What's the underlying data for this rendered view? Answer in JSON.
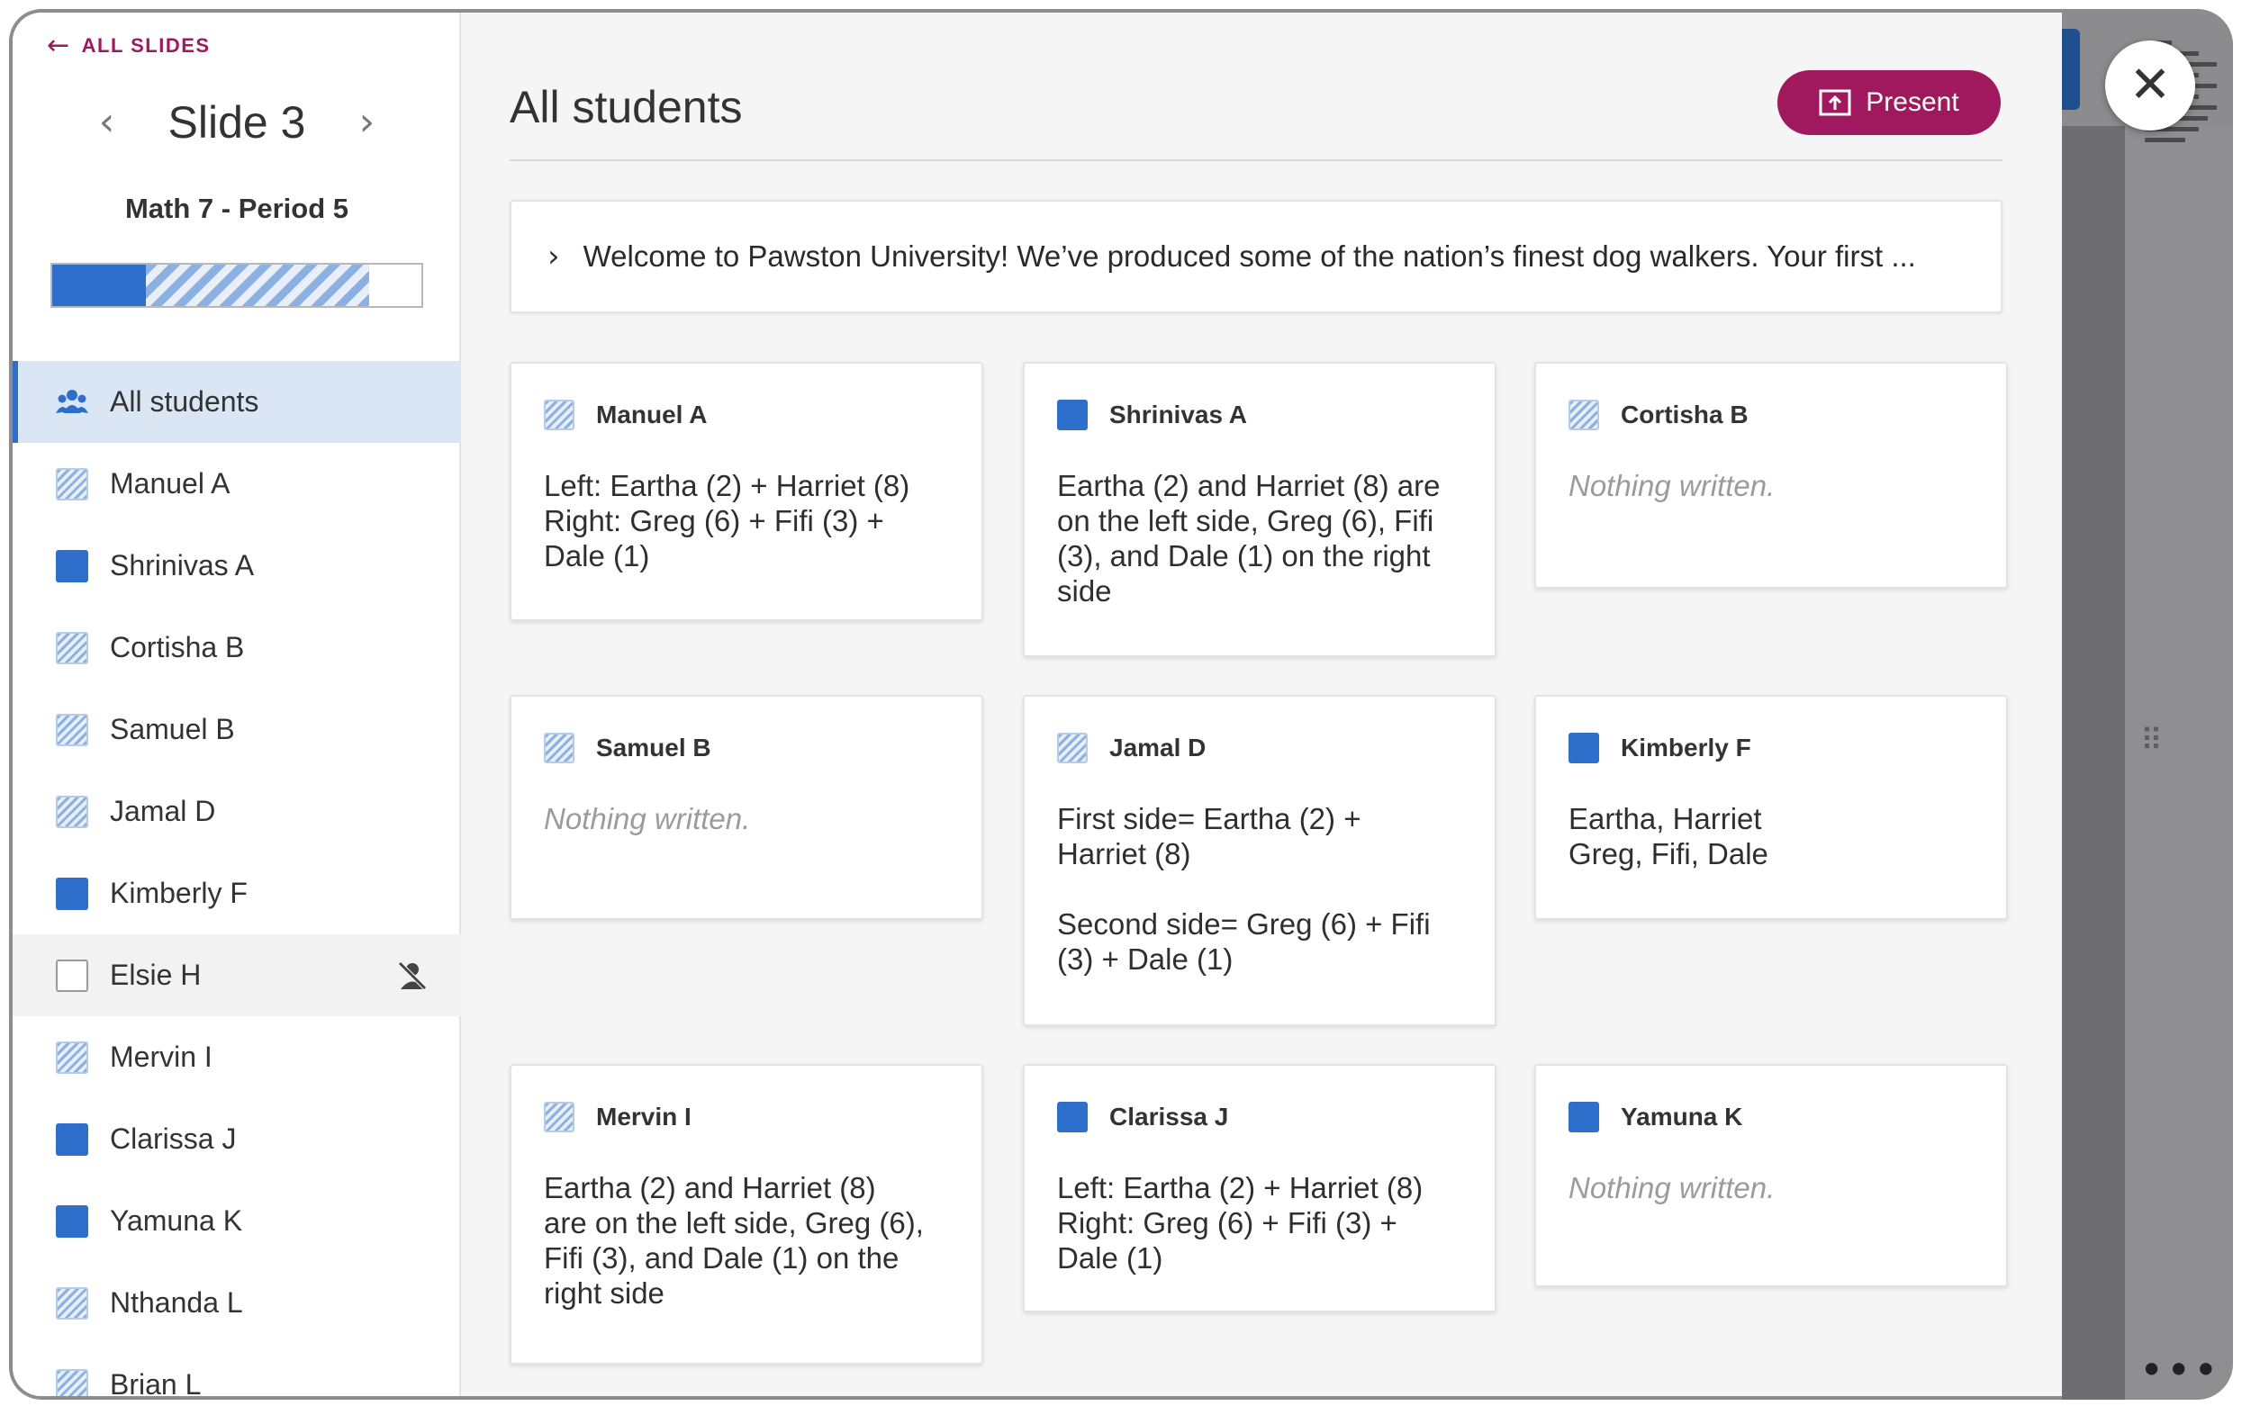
{
  "sidebar": {
    "back_label": "ALL SLIDES",
    "slide_title": "Slide 3",
    "class_name": "Math 7 - Period 5",
    "progress": {
      "submitted_fraction": 0.25,
      "in_progress_fraction": 0.6
    },
    "items": [
      {
        "label": "All students",
        "status": "all"
      },
      {
        "label": "Manuel A",
        "status": "in-progress"
      },
      {
        "label": "Shrinivas A",
        "status": "submitted"
      },
      {
        "label": "Cortisha B",
        "status": "in-progress"
      },
      {
        "label": "Samuel B",
        "status": "in-progress"
      },
      {
        "label": "Jamal D",
        "status": "in-progress"
      },
      {
        "label": "Kimberly F",
        "status": "submitted"
      },
      {
        "label": "Elsie H",
        "status": "not-started"
      },
      {
        "label": "Mervin I",
        "status": "in-progress"
      },
      {
        "label": "Clarissa J",
        "status": "submitted"
      },
      {
        "label": "Yamuna K",
        "status": "submitted"
      },
      {
        "label": "Nthanda L",
        "status": "in-progress"
      },
      {
        "label": "Brian L",
        "status": "in-progress"
      }
    ]
  },
  "main": {
    "title": "All students",
    "present_label": "Present",
    "prompt": "Welcome to Pawston University! We’ve produced some of the nation’s finest dog walkers. Your first ...",
    "cards": [
      {
        "name": "Manuel A",
        "status": "in-progress",
        "body": "Left: Eartha (2) + Harriet (8)\nRight: Greg (6) + Fifi (3) +\nDale (1)",
        "empty": false
      },
      {
        "name": "Shrinivas A",
        "status": "submitted",
        "body": "Eartha (2) and Harriet (8) are\non the left side, Greg (6), Fifi\n(3), and Dale (1) on the right\nside",
        "empty": false
      },
      {
        "name": "Cortisha B",
        "status": "in-progress",
        "body": "Nothing written.",
        "empty": true
      },
      {
        "name": "Samuel B",
        "status": "in-progress",
        "body": "Nothing written.",
        "empty": true
      },
      {
        "name": "Jamal D",
        "status": "in-progress",
        "body": "First side= Eartha (2) +\nHarriet (8)\n\nSecond side= Greg (6) + Fifi\n(3) + Dale (1)",
        "empty": false
      },
      {
        "name": "Kimberly F",
        "status": "submitted",
        "body": "Eartha, Harriet\nGreg, Fifi, Dale",
        "empty": false
      },
      {
        "name": "Mervin I",
        "status": "in-progress",
        "body": "Eartha (2) and Harriet (8)\nare on the left side, Greg (6),\nFifi (3), and Dale (1) on the\nright side",
        "empty": false
      },
      {
        "name": "Clarissa J",
        "status": "submitted",
        "body": "Left: Eartha (2) + Harriet (8)\nRight: Greg (6) + Fifi (3) +\nDale (1)",
        "empty": false
      },
      {
        "name": "Yamuna K",
        "status": "submitted",
        "body": "Nothing written.",
        "empty": true
      }
    ]
  },
  "colors": {
    "accent": "#a0185e",
    "status_blue": "#2d6fcb",
    "active_row": "#dbe6f4"
  },
  "icons": {
    "back": "arrow-left-icon",
    "prev": "chevron-left-icon",
    "next": "chevron-right-icon",
    "all_students": "people-group-icon",
    "offline": "person-off-icon",
    "present": "present-screen-icon",
    "expand": "chevron-right-icon",
    "close": "close-icon"
  }
}
